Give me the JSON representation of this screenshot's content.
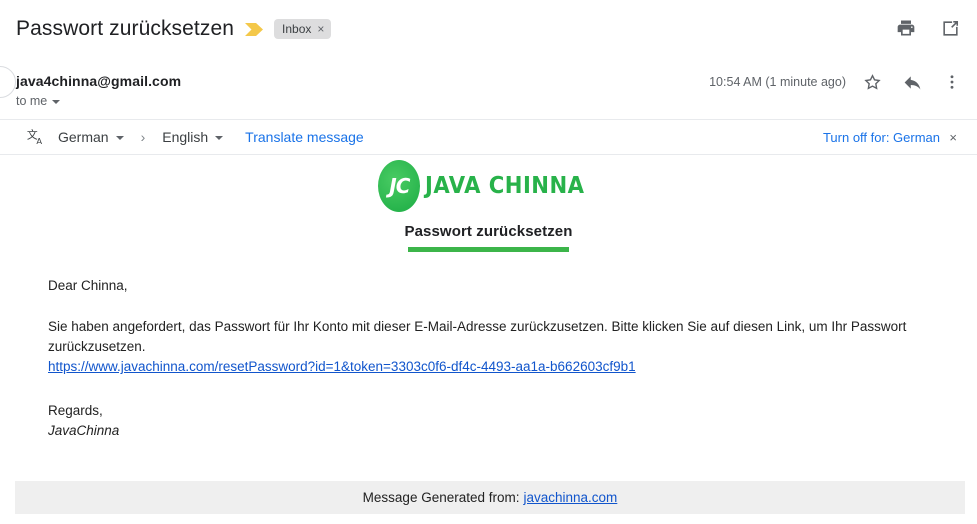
{
  "subject": {
    "text": "Passwort zurücksetzen",
    "important_marker_icon": "important-arrow-icon",
    "label_chip": "Inbox",
    "label_chip_remove": "×",
    "print_icon": "print-icon",
    "open_in_new_icon": "open-in-new-window-icon"
  },
  "sender": {
    "address": "java4chinna@gmail.com",
    "recipient": "to me",
    "timestamp": "10:54 AM (1 minute ago)",
    "star_icon": "star-icon",
    "reply_icon": "reply-icon",
    "more_icon": "more-vertical-icon",
    "avatar": "avatar"
  },
  "translate": {
    "icon": "translate-icon",
    "source_language": "German",
    "arrow": "›",
    "target_language": "English",
    "translate_action": "Translate message",
    "turn_off": "Turn off for: German",
    "close": "×"
  },
  "email": {
    "logo_initials": "JC",
    "logo_wordmark": "JAVA CHINNA",
    "heading": "Passwort zurücksetzen",
    "greeting": "Dear Chinna,",
    "body": "Sie haben angefordert, das Passwort für Ihr Konto mit dieser E-Mail-Adresse zurückzusetzen. Bitte klicken Sie auf diesen Link, um Ihr Passwort zurückzusetzen.",
    "reset_link": "https://www.javachinna.com/resetPassword?id=1&token=3303c0f6-df4c-4493-aa1a-b662603cf9b1",
    "closing": "Regards,",
    "signature": "JavaChinna",
    "footer_text": "Message Generated from:",
    "footer_link": "javachinna.com"
  },
  "colors": {
    "brand_green": "#28b24a",
    "heading_underline": "#3cb54a",
    "link_blue": "#1155cc",
    "gmail_blue": "#1a73e8",
    "important_marker": "#f2c94c",
    "footer_bg": "#efefef"
  }
}
